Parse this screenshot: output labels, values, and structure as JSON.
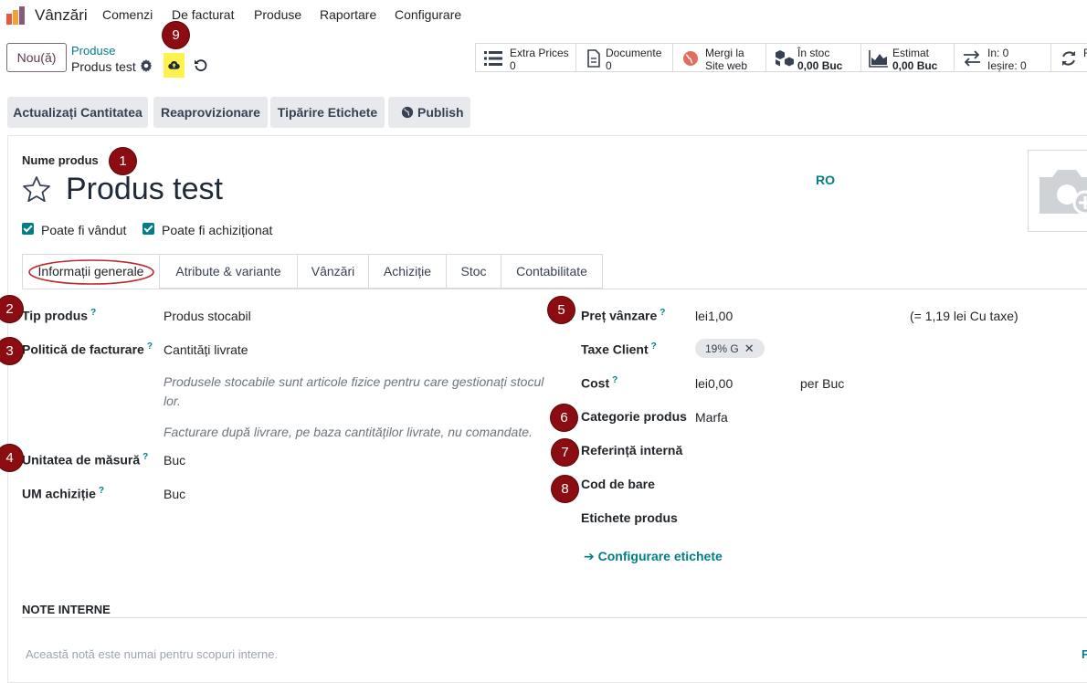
{
  "nav": {
    "app_name": "Vânzări",
    "menu": [
      "Comenzi",
      "De facturat",
      "Produse",
      "Raportare",
      "Configurare"
    ]
  },
  "control": {
    "new_label": "Nou(ă)",
    "breadcrumb_parent": "Produse",
    "breadcrumb_current": "Produs test"
  },
  "stats": [
    {
      "l1": "Extra Prices",
      "l2": "0",
      "icon": "list-icon"
    },
    {
      "l1": "Documente",
      "l2": "0",
      "icon": "document-icon"
    },
    {
      "l1": "Mergi la",
      "l2": "Site web",
      "icon": "globe-icon"
    },
    {
      "l1": "În stoc",
      "l2": "0,00 Buc",
      "icon": "cubes-icon"
    },
    {
      "l1": "Estimat",
      "l2": "0,00 Buc",
      "icon": "area-chart-icon"
    },
    {
      "l1": "In: 0",
      "l2": "Ieșire: 0",
      "icon": "exchange-icon"
    },
    {
      "l1": "R",
      "l2": "",
      "icon": "refresh-icon"
    }
  ],
  "actions": [
    "Actualizați Cantitatea",
    "Reaprovizionare",
    "Tipărire Etichete",
    "Publish"
  ],
  "annotations": [
    "1",
    "2",
    "3",
    "4",
    "5",
    "6",
    "7",
    "8",
    "9"
  ],
  "form": {
    "name_label": "Nume produs",
    "name": "Produs test",
    "lang": "RO",
    "can_be_sold": "Poate fi vândut",
    "can_be_purchased": "Poate fi achiziționat",
    "tabs": [
      "Informații generale",
      "Atribute & variante",
      "Vânzări",
      "Achiziție",
      "Stoc",
      "Contabilitate"
    ],
    "left": {
      "tip_label": "Tip produs",
      "tip_value": "Produs stocabil",
      "policy_label": "Politică de facturare",
      "policy_value": "Cantități livrate",
      "hint1": "Produsele stocabile sunt articole fizice pentru care gestionați stocul lor.",
      "hint2": "Facturare după livrare, pe baza cantităților livrate, nu comandate.",
      "uom_label": "Unitatea de măsură",
      "uom_value": "Buc",
      "uom_po_label": "UM achiziție",
      "uom_po_value": "Buc"
    },
    "right": {
      "price_label": "Preț vânzare",
      "price_value": "lei1,00",
      "price_tax": "(= 1,19 lei Cu taxe)",
      "tax_label": "Taxe Client",
      "tax_chip": "19% G",
      "cost_label": "Cost",
      "cost_value": "lei0,00",
      "cost_unit": "per Buc",
      "categ_label": "Categorie produs",
      "categ_value": "Marfa",
      "ref_label": "Referință internă",
      "barcode_label": "Cod de bare",
      "tags_label": "Etichete produs",
      "config_link": "Configurare etichete"
    },
    "notes_title": "NOTE INTERNE",
    "notes_placeholder": "Această notă este numai pentru scopuri interne.",
    "stray_char": "F"
  },
  "colors": {
    "accent": "#017e84",
    "badge": "#8b0d12",
    "highlight": "#fdf24e"
  }
}
